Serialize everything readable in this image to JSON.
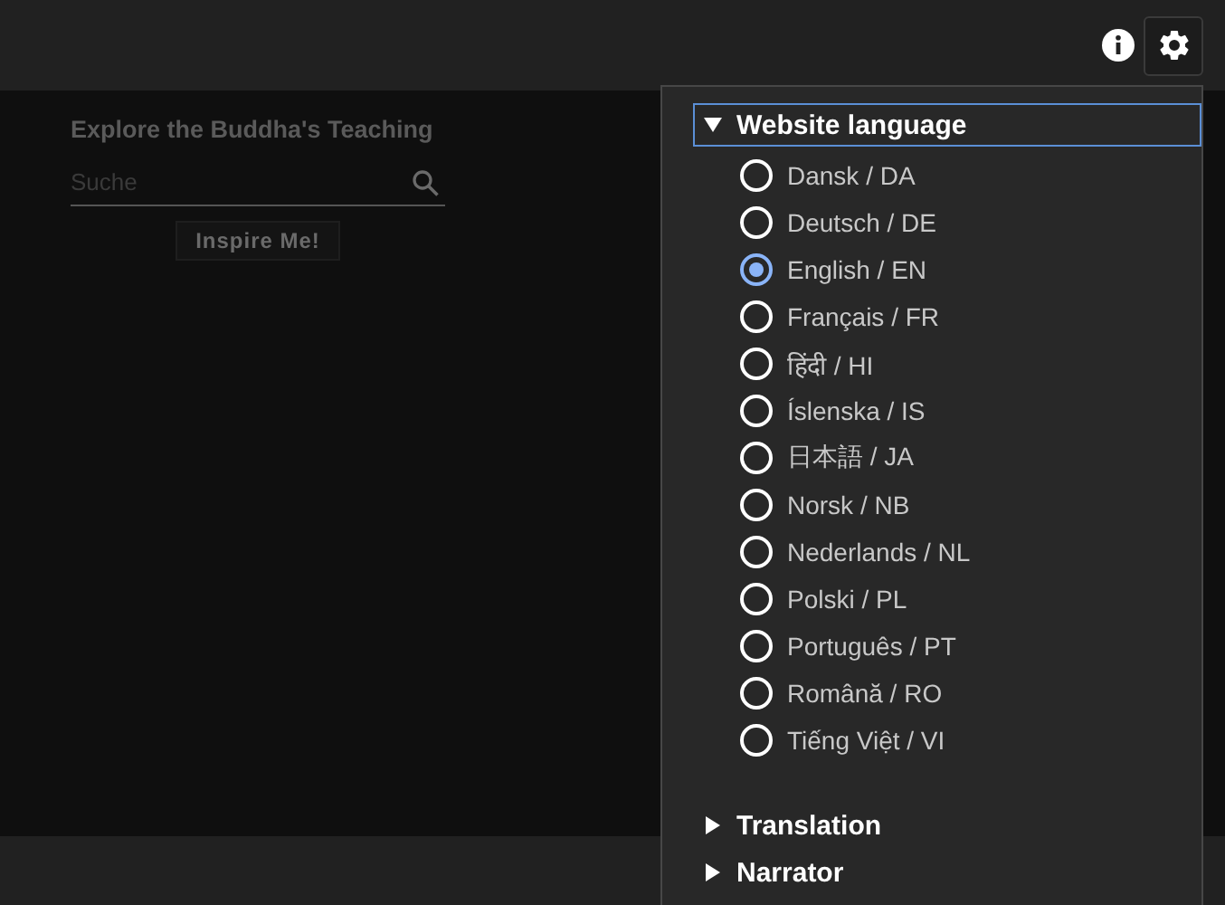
{
  "main": {
    "title": "Explore the Buddha's Teaching",
    "search": {
      "placeholder": "Suche"
    },
    "inspire_button": "Inspire Me!"
  },
  "settings_menu": {
    "sections": [
      {
        "title": "Website language",
        "expanded": true,
        "focused": true,
        "options": [
          {
            "label": "Dansk / DA",
            "selected": false
          },
          {
            "label": "Deutsch / DE",
            "selected": false
          },
          {
            "label": "English / EN",
            "selected": true
          },
          {
            "label": "Français / FR",
            "selected": false
          },
          {
            "label": "हिंदी / HI",
            "selected": false
          },
          {
            "label": "Íslenska / IS",
            "selected": false
          },
          {
            "label": "日本語 / JA",
            "selected": false
          },
          {
            "label": "Norsk / NB",
            "selected": false
          },
          {
            "label": "Nederlands / NL",
            "selected": false
          },
          {
            "label": "Polski / PL",
            "selected": false
          },
          {
            "label": "Português / PT",
            "selected": false
          },
          {
            "label": "Română / RO",
            "selected": false
          },
          {
            "label": "Tiếng Việt / VI",
            "selected": false
          }
        ]
      },
      {
        "title": "Translation",
        "expanded": false,
        "focused": false
      },
      {
        "title": "Narrator",
        "expanded": false,
        "focused": false
      }
    ]
  }
}
